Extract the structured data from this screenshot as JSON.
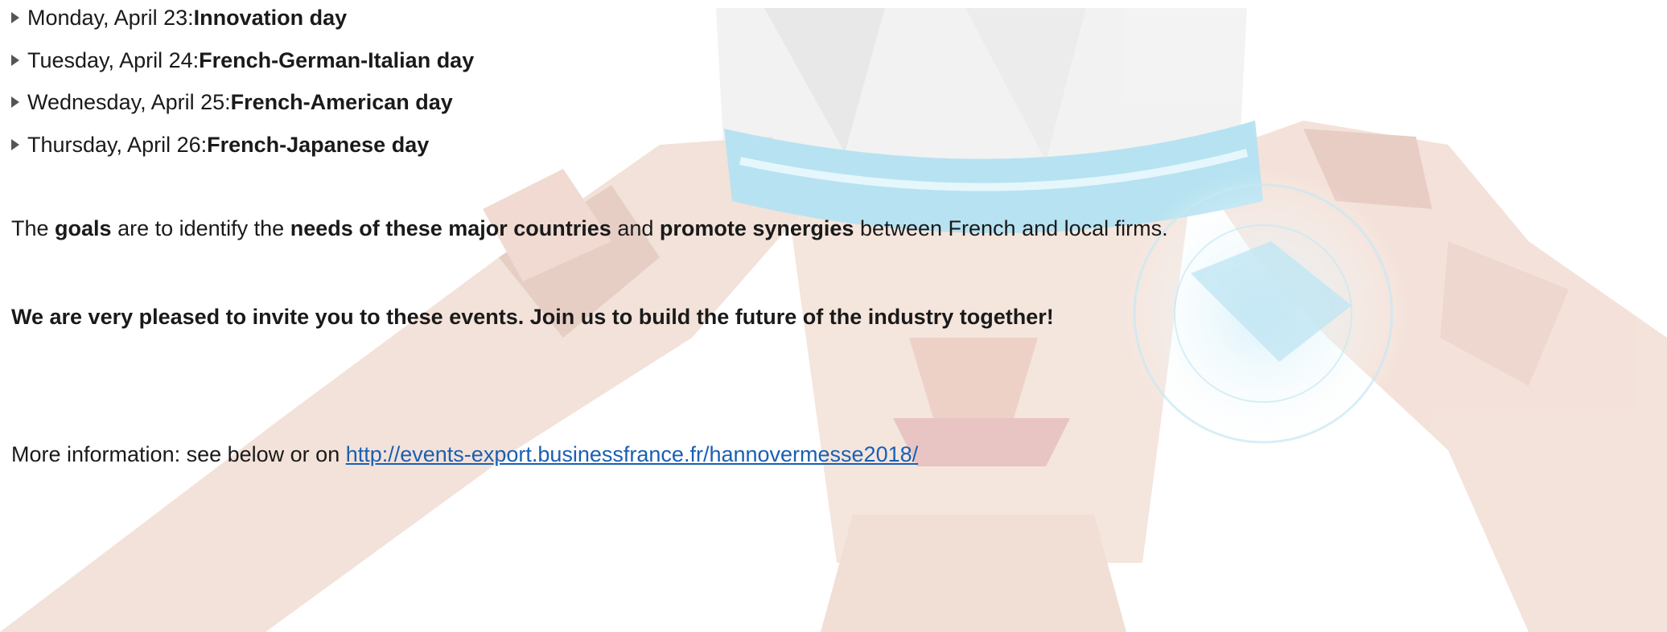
{
  "schedule": [
    {
      "date": "Monday, April 23: ",
      "theme": "Innovation day"
    },
    {
      "date": "Tuesday, April 24: ",
      "theme": "French-German-Italian day"
    },
    {
      "date": "Wednesday, April 25: ",
      "theme": "French-American day"
    },
    {
      "date": "Thursday, April 26: ",
      "theme": "French-Japanese day"
    }
  ],
  "goals": {
    "t1": "The ",
    "b1": "goals",
    "t2": " are to identify the ",
    "b2": "needs of these major countries",
    "t3": " and ",
    "b3": "promote synergies",
    "t4": " between French and local firms."
  },
  "invitation": "We are very pleased to invite you to these events. Join us to build the future of the industry together!",
  "more_info": {
    "prefix": "More information: see below or on ",
    "link": "http://events-export.businessfrance.fr/hannovermesse2018/"
  },
  "colors": {
    "link": "#1a5fb4",
    "hologram": "#8fd3ea",
    "skin": "#e8c9b8"
  }
}
